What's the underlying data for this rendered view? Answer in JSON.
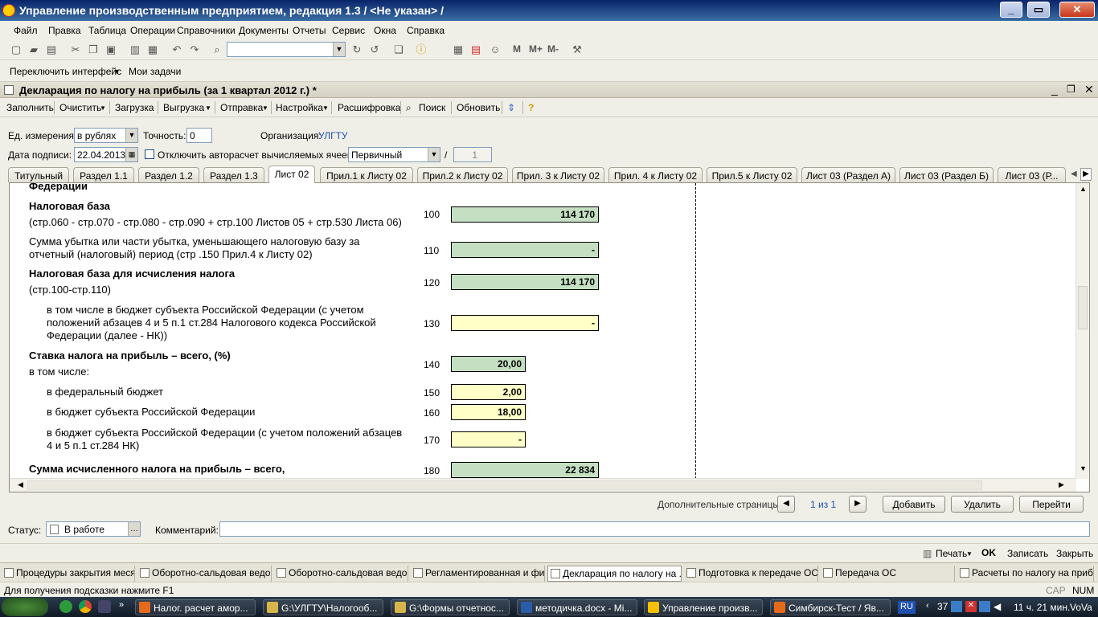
{
  "window": {
    "title": "Управление производственным предприятием, редакция 1.3 / <Не указан> /"
  },
  "menu": [
    "Файл",
    "Правка",
    "Таблица",
    "Операции",
    "Справочники",
    "Документы",
    "Отчеты",
    "Сервис",
    "Окна",
    "Справка"
  ],
  "toolbar": {
    "memory_buttons": [
      "M",
      "M+",
      "M-"
    ]
  },
  "toolbar2": {
    "switch_interface": "Переключить интерфейс",
    "my_tasks": "Мои задачи"
  },
  "document": {
    "title": "Декларация по налогу на прибыль (за 1 квартал 2012 г.) *",
    "commands": {
      "fill": "Заполнить",
      "clear": "Очистить",
      "load": "Загрузка",
      "unload": "Выгрузка",
      "send": "Отправка",
      "settings": "Настройка",
      "decode": "Расшифровка",
      "search": "Поиск",
      "refresh": "Обновить"
    },
    "form": {
      "unit_label": "Ед. измерения:",
      "unit_value": "в рублях",
      "precision_label": "Точность:",
      "precision_value": "0",
      "org_label": "Организация:",
      "org_value": "УЛГТУ",
      "date_label": "Дата подписи:",
      "date_value": "22.04.2013",
      "autocalc_label": "Отключить авторасчет вычисляемых ячеек",
      "kind_value": "Первичный",
      "slash": "/",
      "correction_value": "1"
    },
    "tabs": [
      "Титульный",
      "Раздел 1.1",
      "Раздел 1.2",
      "Раздел 1.3",
      "Лист 02",
      "Прил.1 к Листу 02",
      "Прил.2 к Листу 02",
      "Прил. 3 к Листу 02",
      "Прил. 4 к Листу 02",
      "Прил.5 к Листу 02",
      "Лист 03 (Раздел А)",
      "Лист 03 (Раздел Б)",
      "Лист 03 (Р..."
    ],
    "sheet": {
      "top_partial": "Федерации",
      "rows": [
        {
          "title": "Налоговая база",
          "subtitle": "(стр.060 - стр.070 - стр.080 - стр.090 + стр.100 Листов 05 + стр.530 Листа 06)",
          "code": "100",
          "value": "114 170"
        },
        {
          "text": "Сумма убытка или части убытка, уменьшающего налоговую базу за отчетный (налоговый) период (стр .150 Прил.4 к Листу 02)",
          "code": "110",
          "value": "-"
        },
        {
          "title": "Налоговая база для исчисления налога",
          "subtitle": "(стр.100-стр.110)",
          "code": "120",
          "value": "114 170"
        },
        {
          "text": "в том числе в бюджет субъекта Российской Федерации (с учетом положений абзацев 4 и 5 п.1 ст.284 Налогового кодекса Российской Федерации (далее - НК))",
          "code": "130",
          "value": "-"
        },
        {
          "title": "Ставка налога на прибыль – всего, (%)",
          "subtitle": "в том числе:",
          "code": "140",
          "value": "20,00"
        },
        {
          "text": "в федеральный бюджет",
          "code": "150",
          "value": "2,00"
        },
        {
          "text": "в бюджет субъекта Российской Федерации",
          "code": "160",
          "value": "18,00"
        },
        {
          "text": "в бюджет субъекта Российской Федерации (с учетом положений абзацев 4 и 5 п.1 ст.284 НК)",
          "code": "170",
          "value": "-"
        },
        {
          "title": "Сумма исчисленного налога на прибыль – всего,",
          "code": "180",
          "value": "22 834"
        }
      ]
    },
    "extra_pages": {
      "label": "Дополнительные страницы:",
      "pager": "1 из 1",
      "add": "Добавить",
      "delete": "Удалить",
      "go": "Перейти"
    },
    "status_label": "Статус:",
    "status_value": "В работе",
    "comment_label": "Комментарий:",
    "bottom": {
      "print": "Печать",
      "ok": "OK",
      "save": "Записать",
      "close": "Закрыть"
    }
  },
  "window_tabs": [
    "Процедуры закрытия меся...",
    "Оборотно-сальдовая ведо...",
    "Оборотно-сальдовая ведо...",
    "Регламентированная и фи...",
    "Декларация по налогу на ...",
    "Подготовка к передаче ОС",
    "Передача ОС",
    "Расчеты по налогу на приб..."
  ],
  "statusbar": {
    "hint": "Для получения подсказки нажмите F1",
    "cap": "CAP",
    "num": "NUM",
    "user": "VoVa"
  },
  "taskbar": {
    "items": [
      "Налог. расчет амор...",
      "G:\\УЛГТУ\\Налогооб...",
      "G:\\Формы отчетнос...",
      "методичка.docx - Mi...",
      "Управление произв...",
      "Симбирск-Тест / Яв..."
    ],
    "lang": "RU",
    "tray_number": "37",
    "clock": "11 ч. 21 мин."
  }
}
